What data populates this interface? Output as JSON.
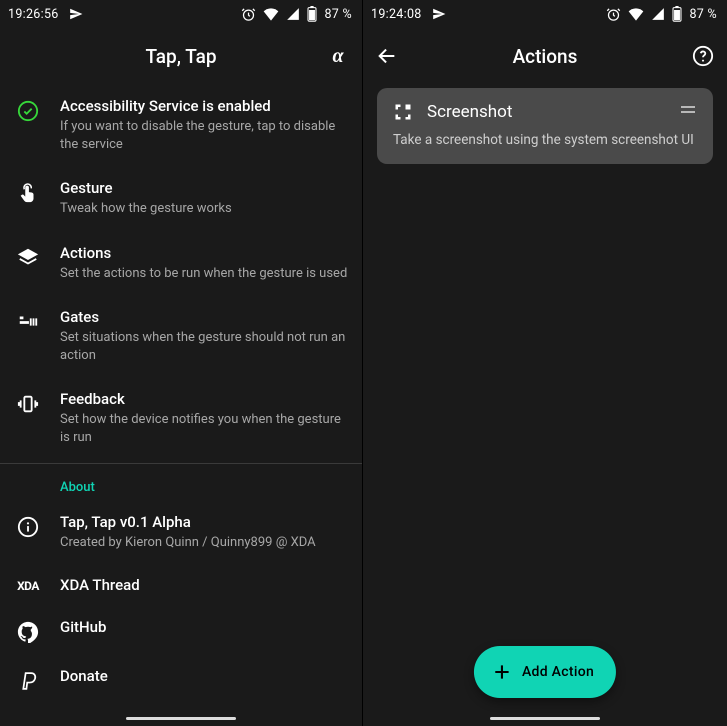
{
  "left": {
    "status": {
      "time": "19:26:56",
      "battery": "87 %"
    },
    "appbar": {
      "title": "Tap, Tap"
    },
    "items": [
      {
        "title": "Accessibility Service is enabled",
        "sub": "If you want to disable the gesture, tap to disable the service"
      },
      {
        "title": "Gesture",
        "sub": "Tweak how the gesture works"
      },
      {
        "title": "Actions",
        "sub": "Set the actions to be run when the gesture is used"
      },
      {
        "title": "Gates",
        "sub": "Set situations when the gesture should not run an action"
      },
      {
        "title": "Feedback",
        "sub": "Set how the device notifies you when the gesture is run"
      }
    ],
    "about_label": "About",
    "about": [
      {
        "title": "Tap, Tap v0.1 Alpha",
        "sub": "Created by Kieron Quinn / Quinny899 @ XDA"
      },
      {
        "title": "XDA Thread"
      },
      {
        "title": "GitHub"
      },
      {
        "title": "Donate"
      }
    ]
  },
  "right": {
    "status": {
      "time": "19:24:08",
      "battery": "87 %"
    },
    "appbar": {
      "title": "Actions"
    },
    "card": {
      "title": "Screenshot",
      "sub": "Take a screenshot using the system screenshot UI"
    },
    "fab": "Add Action"
  }
}
